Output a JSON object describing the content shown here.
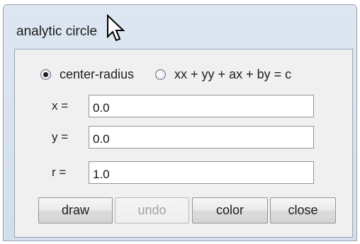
{
  "window": {
    "title": "analytic circle"
  },
  "mode": {
    "options": [
      {
        "label": "center-radius",
        "selected": true
      },
      {
        "label": "xx + yy + ax + by = c",
        "selected": false
      }
    ]
  },
  "fields": [
    {
      "label": "x =",
      "value": "0.0"
    },
    {
      "label": "y =",
      "value": "0.0"
    },
    {
      "label": "r =",
      "value": "1.0"
    }
  ],
  "buttons": {
    "draw": {
      "label": "draw",
      "enabled": true
    },
    "undo": {
      "label": "undo",
      "enabled": false
    },
    "color": {
      "label": "color",
      "enabled": true
    },
    "close": {
      "label": "close",
      "enabled": true
    }
  },
  "cursor": {
    "icon": "mouse-pointer-icon"
  }
}
